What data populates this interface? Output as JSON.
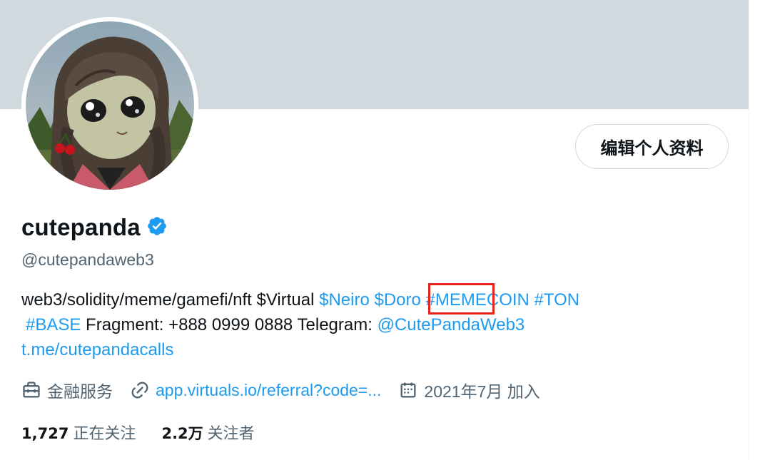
{
  "profile": {
    "edit_button_label": "编辑个人资料",
    "name": "cutepanda",
    "handle": "@cutepandaweb3",
    "verified_color": "#1d9bf0",
    "bio": {
      "line1": {
        "text1": "web3/solidity/meme/gamefi/nft $Virtual ",
        "neiro": "$Neiro",
        "space1": " ",
        "doro": "$Doro",
        "space2": " ",
        "memecoin": "#MEMECOIN",
        "space3": " ",
        "ton": "#TON"
      },
      "line2": {
        "base": "#BASE",
        "text1": " Fragment: +888 0999 0888 Telegram: ",
        "tg": "@CutePandaWeb3"
      },
      "line3": {
        "link": "t.me/cutepandacalls"
      }
    },
    "meta": {
      "category": "金融服务",
      "category_icon": "briefcase-icon",
      "url": "app.virtuals.io/referral?code=...",
      "url_icon": "link-icon",
      "joined": "2021年7月 加入",
      "joined_icon": "calendar-icon"
    },
    "stats": {
      "following_count": "1,727",
      "following_label": "正在关注",
      "followers_count": "2.2万",
      "followers_label": "关注者"
    }
  },
  "colors": {
    "banner": "#cfd9de",
    "accent": "#1d9bf0",
    "secondary_text": "#536471",
    "highlight_box": "#e8231c"
  }
}
